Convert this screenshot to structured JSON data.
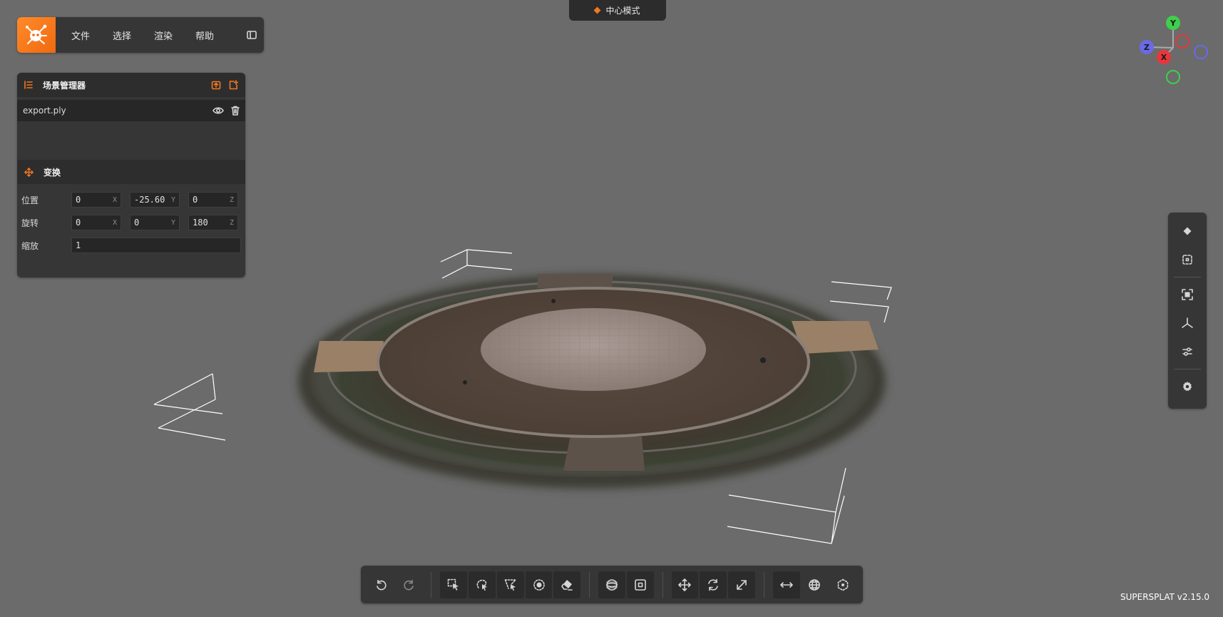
{
  "menu": {
    "items": [
      {
        "label": "文件"
      },
      {
        "label": "选择"
      },
      {
        "label": "渲染"
      },
      {
        "label": "帮助"
      }
    ]
  },
  "mode": {
    "label": "中心模式"
  },
  "scene_manager": {
    "title": "场景管理器",
    "items": [
      {
        "name": "export.ply"
      }
    ]
  },
  "transform": {
    "title": "变换",
    "position": {
      "label": "位置",
      "x": "0",
      "y": "-25.60",
      "z": "0"
    },
    "rotation": {
      "label": "旋转",
      "x": "0",
      "y": "0",
      "z": "180"
    },
    "scale": {
      "label": "缩放",
      "value": "1"
    },
    "axis_labels": {
      "x": "X",
      "y": "Y",
      "z": "Z"
    }
  },
  "gizmo": {
    "x": "X",
    "y": "Y",
    "z": "Z"
  },
  "version": "SUPERSPLAT v2.15.0",
  "colors": {
    "accent": "#f07820",
    "background": "#6b6b6b",
    "panel": "#363636",
    "axis_x": "#e8373a",
    "axis_y": "#3fcf4b",
    "axis_z": "#6a6ae8"
  },
  "icons": {
    "logo": "supersplat-logo",
    "right_toolbar": [
      "diamond-icon",
      "frame-selection-icon",
      "focus-icon",
      "axes-icon",
      "sliders-icon",
      "gear-icon"
    ],
    "bottom_toolbar": [
      "undo-icon",
      "redo-icon",
      "rect-select-icon",
      "lasso-select-icon",
      "polygon-select-icon",
      "brush-select-icon",
      "eraser-icon",
      "sphere-select-icon",
      "box-select-icon",
      "move-icon",
      "rotate-icon",
      "scale-icon",
      "measure-icon",
      "globe-icon",
      "origin-icon"
    ]
  }
}
